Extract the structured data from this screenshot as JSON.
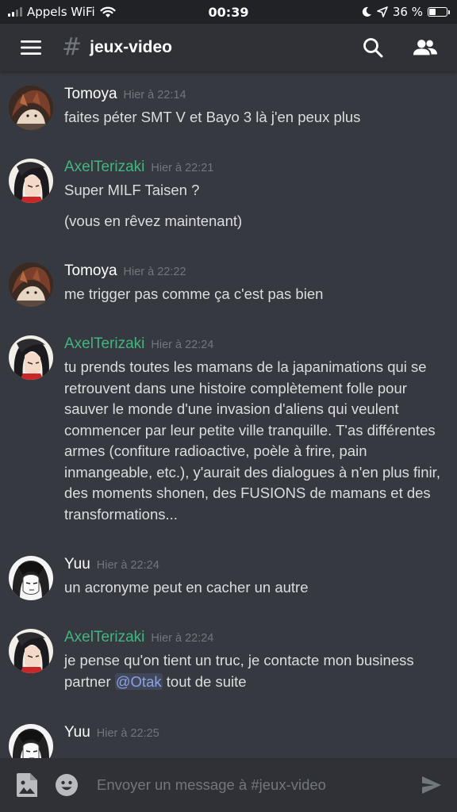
{
  "status_bar": {
    "carrier": "Appels WiFi",
    "time": "00:39",
    "battery_percent": "36 %",
    "battery_level": 0.36
  },
  "header": {
    "channel_prefix": "#",
    "channel_name": "jeux-video",
    "icons": [
      "menu-icon",
      "search-icon",
      "members-icon"
    ]
  },
  "messages": [
    {
      "author": "Tomoya",
      "author_color": "#ffffff",
      "timestamp": "Hier à 22:14",
      "lines": [
        "faites péter SMT V et Bayo 3 là j'en peux plus"
      ]
    },
    {
      "author": "AxelTerizaki",
      "author_color": "#43b581",
      "timestamp": "Hier à 22:21",
      "lines": [
        "Super MILF Taisen ?",
        "(vous en rêvez maintenant)"
      ]
    },
    {
      "author": "Tomoya",
      "author_color": "#ffffff",
      "timestamp": "Hier à 22:22",
      "lines": [
        "me trigger pas comme ça c'est pas bien"
      ]
    },
    {
      "author": "AxelTerizaki",
      "author_color": "#43b581",
      "timestamp": "Hier à 22:24",
      "lines": [
        "tu prends toutes les mamans de la japanimations qui se retrouvent dans une histoire complètement folle pour sauver le monde d'une invasion d'aliens qui veulent commencer par leur petite ville tranquille. T'as différentes armes (confiture radioactive, poèle à frire, pain inmangeable, etc.), y'aurait des dialogues à n'en plus finir, des moments shonen, des FUSIONS de mamans et des transformations..."
      ]
    },
    {
      "author": "Yuu",
      "author_color": "#ffffff",
      "timestamp": "Hier à 22:24",
      "lines": [
        "un acronyme peut en cacher un autre"
      ]
    },
    {
      "author": "AxelTerizaki",
      "author_color": "#43b581",
      "timestamp": "Hier à 22:24",
      "text_before_mention": "je pense qu'on tient un truc, je contacte mon business partner ",
      "mention": "@Otak",
      "text_after_mention": " tout de suite"
    },
    {
      "author": "Yuu",
      "author_color": "#ffffff",
      "timestamp": "Hier à 22:25",
      "lines": []
    }
  ],
  "input_bar": {
    "placeholder": "Envoyer un message à #jeux-video",
    "icons": [
      "image-icon",
      "emoji-icon",
      "send-icon"
    ]
  },
  "colors": {
    "background": "#36393f",
    "header": "#2f3136",
    "status_bar": "#202225",
    "role_green": "#43b581",
    "mention": "#8ea1e1"
  }
}
